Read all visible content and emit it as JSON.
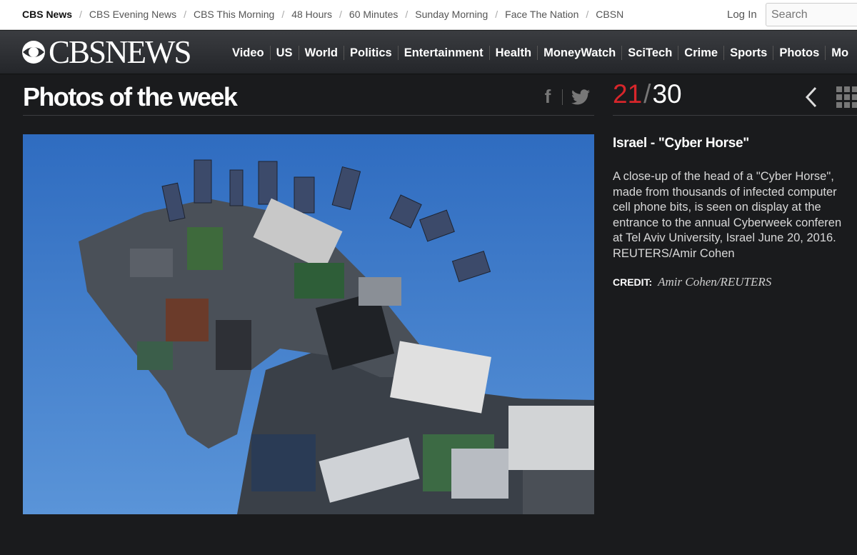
{
  "topbar": {
    "links": [
      "CBS News",
      "CBS Evening News",
      "CBS This Morning",
      "48 Hours",
      "60 Minutes",
      "Sunday Morning",
      "Face The Nation",
      "CBSN"
    ],
    "separator": "/",
    "login": "Log In",
    "search_placeholder": "Search"
  },
  "header": {
    "logo_text": "CBSNEWS",
    "nav": [
      "Video",
      "US",
      "World",
      "Politics",
      "Entertainment",
      "Health",
      "MoneyWatch",
      "SciTech",
      "Crime",
      "Sports",
      "Photos",
      "Mo"
    ]
  },
  "gallery": {
    "title": "Photos of the week",
    "current": "21",
    "separator": "/",
    "total": "30"
  },
  "caption": {
    "title": "Israel - \"Cyber Horse\"",
    "lines": [
      "A close-up of the head of a \"Cyber Horse\",",
      "made from thousands of infected computer",
      "cell phone bits, is seen on display at the",
      "entrance to the annual Cyberweek conferen",
      "at Tel Aviv University, Israel June 20, 2016.",
      "REUTERS/Amir Cohen"
    ],
    "credit_label": "CREDIT:",
    "credit_value": "Amir Cohen/REUTERS"
  },
  "icons": {
    "facebook": "facebook-icon",
    "twitter": "twitter-icon",
    "prev": "chevron-left-icon",
    "grid": "grid-icon",
    "logo": "cbs-eye-icon"
  },
  "colors": {
    "accent_red": "#d7262b",
    "page_bg": "#1a1b1d",
    "sky_blue": "#3b78c9"
  }
}
